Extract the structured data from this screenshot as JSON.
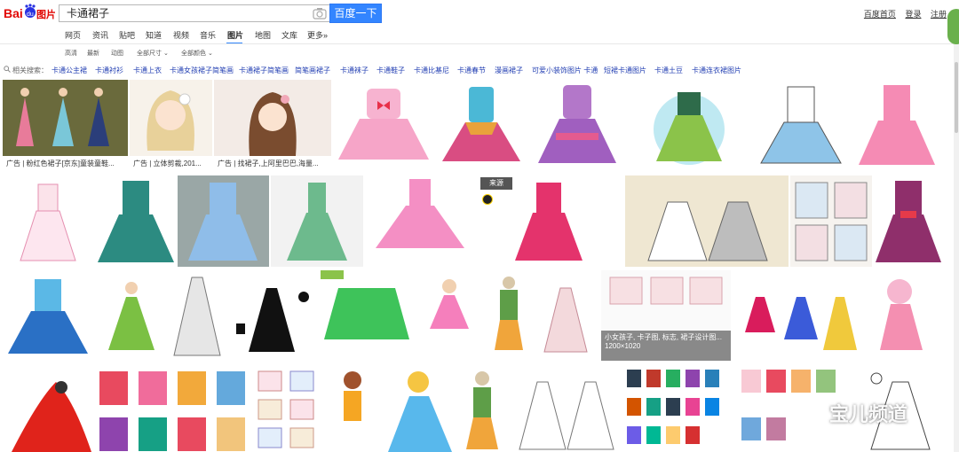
{
  "logo": {
    "text_left": "Bai",
    "text_paw": "du",
    "text_right": "图片"
  },
  "search": {
    "value": "卡通裙子",
    "button_label": "百度一下"
  },
  "top_links": [
    "百度首页",
    "登录",
    "注册"
  ],
  "nav": {
    "tabs": [
      "网页",
      "资讯",
      "贴吧",
      "知道",
      "视频",
      "音乐",
      "图片",
      "地图",
      "文库",
      "更多»"
    ],
    "active": "图片"
  },
  "filters": [
    "高清",
    "最新",
    "动图",
    "全部尺寸 ⌄",
    "全部颜色 ⌄"
  ],
  "related": {
    "label": "相关搜索：",
    "items": [
      "卡通公主裙",
      "卡通衬衫",
      "卡通上衣",
      "卡通女孩裙子简笔画",
      "卡通裙子简笔画",
      "简笔画裙子",
      "卡通袜子",
      "卡通鞋子",
      "卡通比基尼",
      "卡通春节",
      "漫画裙子",
      "可爱小装饰图片 卡通",
      "短裙卡通图片",
      "卡通土豆",
      "卡通连衣裙图片"
    ]
  },
  "ads": [
    "广告 | 粉红色裙子[京东]童装童鞋...",
    "广告 | 立体剪裁,201...",
    "广告 | 找裙子,上阿里巴巴,海量..."
  ],
  "hover": {
    "source_label": "来源",
    "caption": "小女孩子, 卡子图, 标志, 裙子设计图...",
    "size": "1200×1020"
  },
  "watermark": "宝儿频道",
  "colors": {
    "accent": "#3385ff",
    "link": "#2440b3"
  }
}
